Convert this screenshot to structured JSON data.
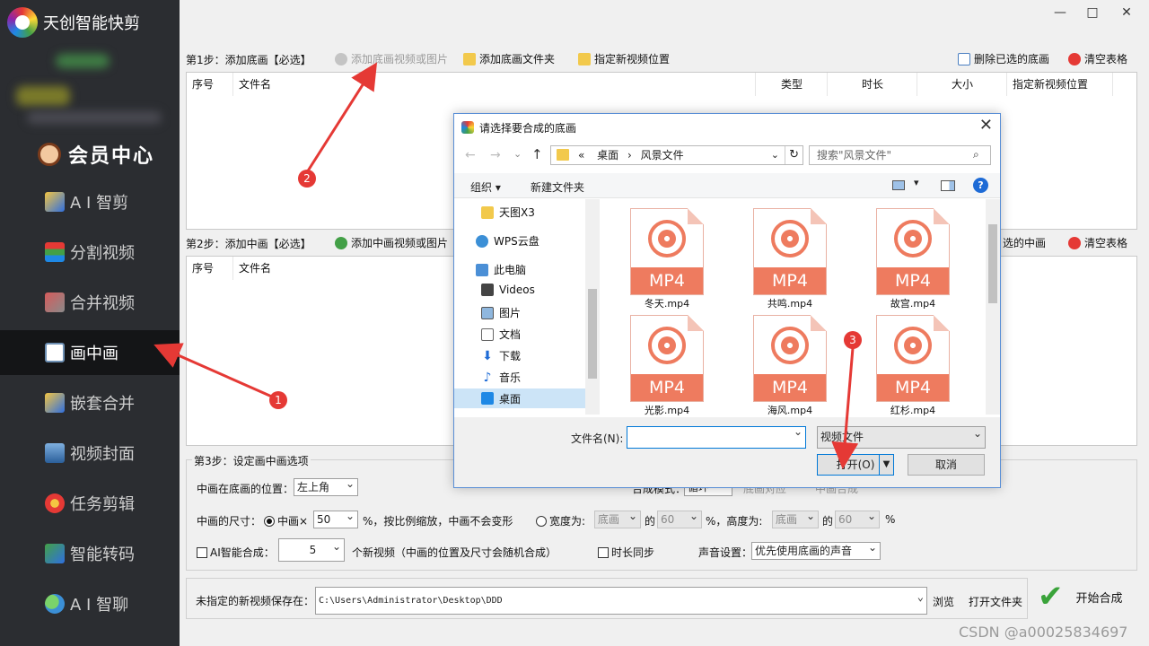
{
  "app": {
    "title": "天创智能快剪"
  },
  "sidebar": {
    "member": "会员中心",
    "items": [
      {
        "label": "A I 智剪"
      },
      {
        "label": "分割视频"
      },
      {
        "label": "合并视频"
      },
      {
        "label": "画中画"
      },
      {
        "label": "嵌套合并"
      },
      {
        "label": "视频封面"
      },
      {
        "label": "任务剪辑"
      },
      {
        "label": "智能转码"
      },
      {
        "label": "A I 智聊"
      }
    ]
  },
  "window": {
    "min": "—",
    "max": "□",
    "close": "✕"
  },
  "step1": {
    "label": "第1步：添加底画【必选】",
    "add_media": "添加底画视频或图片",
    "add_folder": "添加底画文件夹",
    "set_location": "指定新视频位置",
    "delete_selected": "删除已选的底画",
    "clear_table": "清空表格",
    "columns": [
      "序号",
      "文件名",
      "类型",
      "时长",
      "大小",
      "指定新视频位置"
    ]
  },
  "step2": {
    "label": "第2步：添加中画【必选】",
    "add_media": "添加中画视频或图片",
    "delete_selected": "选的中画",
    "clear_table": "清空表格",
    "columns": [
      "序号",
      "文件名"
    ]
  },
  "step3": {
    "label": "第3步：设定画中画选项",
    "position_label": "中画在底画的位置：",
    "position_value": "左上角",
    "mode_label": "合成模式：",
    "mode_value": "循环",
    "mode_opt1": "底画对应",
    "mode_opt2": "中画合成",
    "size_label": "中画的尺寸：",
    "scale_radio": "中画×",
    "scale_value": "50",
    "scale_note": "%，按比例缩放，中画不会变形",
    "width_radio": "宽度为:",
    "width_ref": "底画",
    "of1": "的",
    "width_value": "60",
    "pct1": "%，高度为:",
    "height_ref": "底画",
    "of2": "的",
    "height_value": "60",
    "pct2": "%",
    "ai_label": "AI智能合成：",
    "ai_count": "5",
    "ai_note": "个新视频（中画的位置及尺寸会随机合成）",
    "sync_label": "时长同步",
    "audio_label": "声音设置：",
    "audio_value": "优先使用底画的声音"
  },
  "output": {
    "label": "未指定的新视频保存在：",
    "path": "C:\\Users\\Administrator\\Desktop\\DDD",
    "browse": "浏览",
    "open_folder": "打开文件夹",
    "start": "开始合成"
  },
  "dialog": {
    "title": "请选择要合成的底画",
    "breadcrumb": [
      "«",
      "桌面",
      "›",
      "风景文件"
    ],
    "search_placeholder": "搜索\"风景文件\"",
    "organize": "组织 ▾",
    "new_folder": "新建文件夹",
    "help": "?",
    "tree": [
      {
        "label": "天图X3",
        "icon": "folder-icon"
      },
      {
        "label": "WPS云盘",
        "icon": "cloud-icon"
      },
      {
        "label": "此电脑",
        "icon": "computer-icon"
      },
      {
        "label": "Videos",
        "icon": "video-icon"
      },
      {
        "label": "图片",
        "icon": "picture-icon"
      },
      {
        "label": "文档",
        "icon": "document-icon"
      },
      {
        "label": "下载",
        "icon": "download-icon"
      },
      {
        "label": "音乐",
        "icon": "music-icon"
      },
      {
        "label": "桌面",
        "icon": "desktop-icon"
      }
    ],
    "files": [
      {
        "name": "冬天.mp4",
        "ext": "MP4"
      },
      {
        "name": "共鸣.mp4",
        "ext": "MP4"
      },
      {
        "name": "故宫.mp4",
        "ext": "MP4"
      },
      {
        "name": "光影.mp4",
        "ext": "MP4"
      },
      {
        "name": "海风.mp4",
        "ext": "MP4"
      },
      {
        "name": "红杉.mp4",
        "ext": "MP4"
      }
    ],
    "filename_label": "文件名(N):",
    "filename_value": "",
    "filetype": "视频文件",
    "open": "打开(O)",
    "cancel": "取消"
  },
  "annotations": [
    "1",
    "2",
    "3"
  ],
  "watermark": "CSDN @a00025834697",
  "colors": {
    "sidebar_bg": "#2b2d31",
    "active_bg": "#141517",
    "accent_red": "#e53935",
    "mp4_orange": "#ee7b5f"
  }
}
